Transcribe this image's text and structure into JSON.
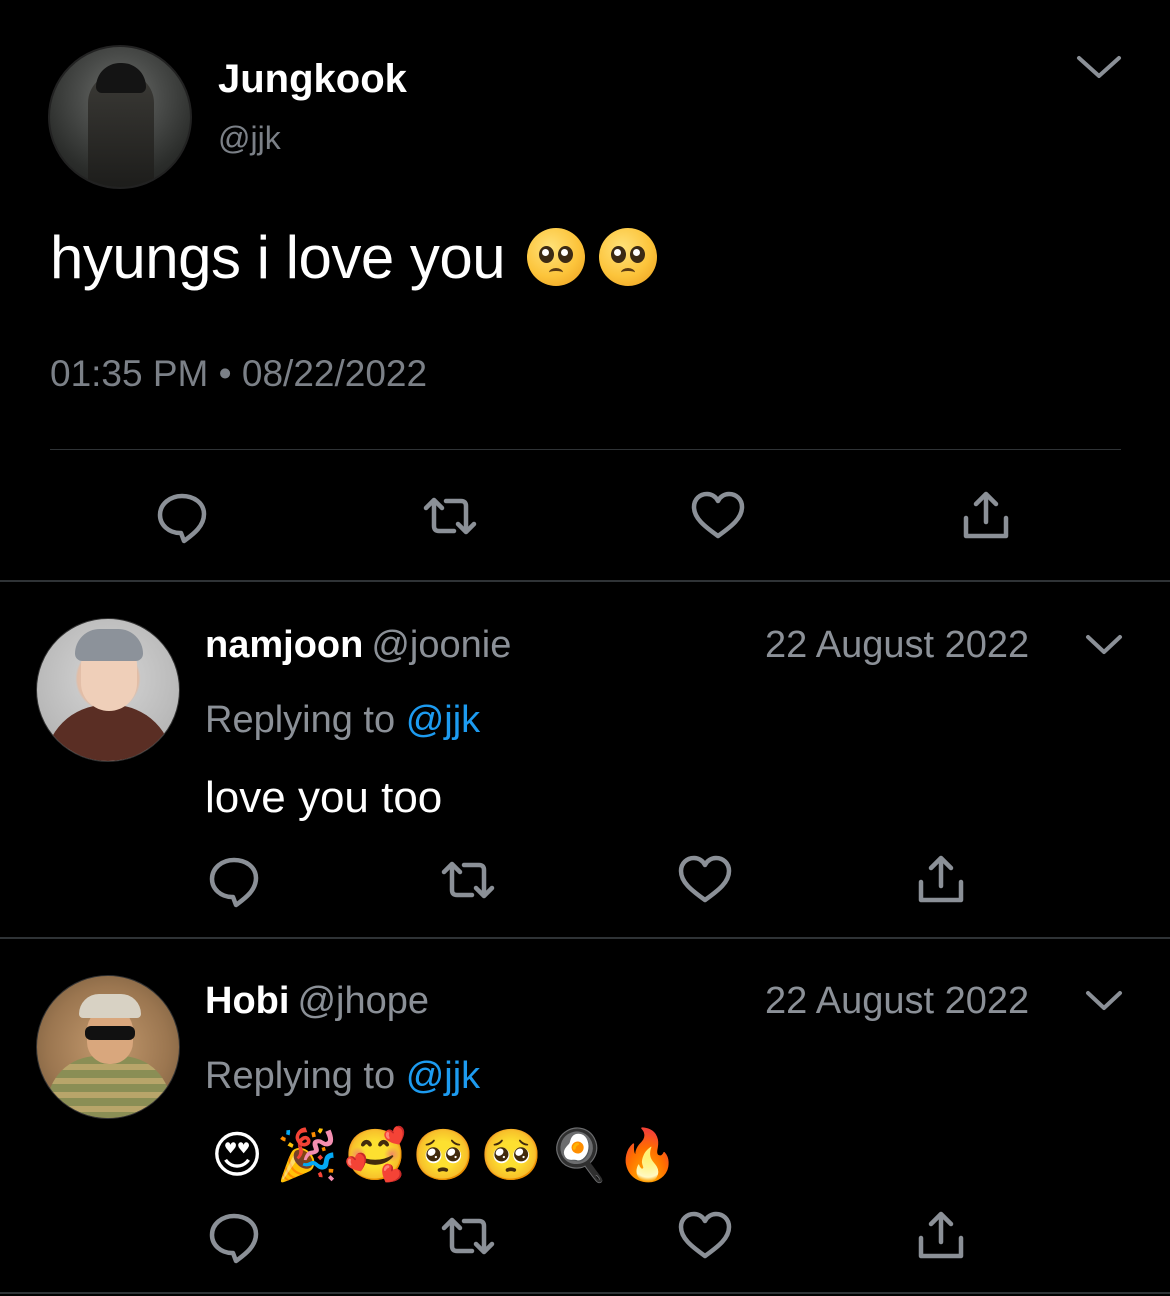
{
  "main_tweet": {
    "display_name": "Jungkook",
    "handle": "@jjk",
    "text": "hyungs i love you",
    "text_emojis": [
      "pleading-face",
      "pleading-face"
    ],
    "timestamp": "01:35 PM • 08/22/2022"
  },
  "replies": [
    {
      "display_name": "namjoon",
      "handle": "@joonie",
      "date": "22 August 2022",
      "replying_prefix": "Replying to",
      "replying_to": "@jjk",
      "text": "love you too"
    },
    {
      "display_name": "Hobi",
      "handle": "@jhope",
      "date": "22 August 2022",
      "replying_prefix": "Replying to",
      "replying_to": "@jjk",
      "emojis": [
        "😍",
        "🎉",
        "🥰",
        "🥺",
        "🥺",
        "🍳",
        "🔥"
      ]
    }
  ],
  "actions": [
    "reply-icon",
    "retweet-icon",
    "like-icon",
    "share-icon"
  ],
  "colors": {
    "background": "#000000",
    "text": "#ffffff",
    "secondary": "#8b9097",
    "mention": "#1d9bf0",
    "divider": "#2f3336"
  }
}
